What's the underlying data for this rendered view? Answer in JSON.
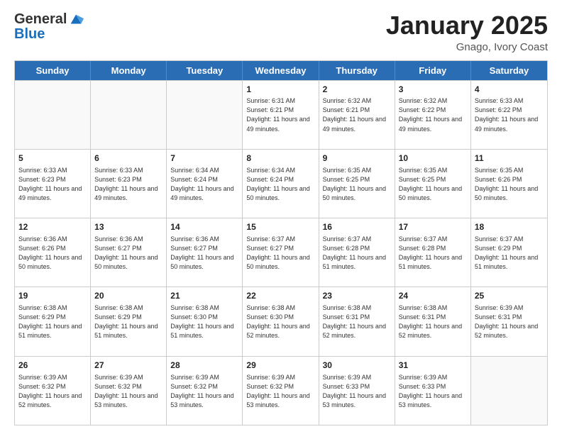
{
  "header": {
    "logo_line1": "General",
    "logo_line2": "Blue",
    "month_title": "January 2025",
    "location": "Gnago, Ivory Coast"
  },
  "days_of_week": [
    "Sunday",
    "Monday",
    "Tuesday",
    "Wednesday",
    "Thursday",
    "Friday",
    "Saturday"
  ],
  "weeks": [
    [
      {
        "day": "",
        "sunrise": "",
        "sunset": "",
        "daylight": ""
      },
      {
        "day": "",
        "sunrise": "",
        "sunset": "",
        "daylight": ""
      },
      {
        "day": "",
        "sunrise": "",
        "sunset": "",
        "daylight": ""
      },
      {
        "day": "1",
        "sunrise": "Sunrise: 6:31 AM",
        "sunset": "Sunset: 6:21 PM",
        "daylight": "Daylight: 11 hours and 49 minutes."
      },
      {
        "day": "2",
        "sunrise": "Sunrise: 6:32 AM",
        "sunset": "Sunset: 6:21 PM",
        "daylight": "Daylight: 11 hours and 49 minutes."
      },
      {
        "day": "3",
        "sunrise": "Sunrise: 6:32 AM",
        "sunset": "Sunset: 6:22 PM",
        "daylight": "Daylight: 11 hours and 49 minutes."
      },
      {
        "day": "4",
        "sunrise": "Sunrise: 6:33 AM",
        "sunset": "Sunset: 6:22 PM",
        "daylight": "Daylight: 11 hours and 49 minutes."
      }
    ],
    [
      {
        "day": "5",
        "sunrise": "Sunrise: 6:33 AM",
        "sunset": "Sunset: 6:23 PM",
        "daylight": "Daylight: 11 hours and 49 minutes."
      },
      {
        "day": "6",
        "sunrise": "Sunrise: 6:33 AM",
        "sunset": "Sunset: 6:23 PM",
        "daylight": "Daylight: 11 hours and 49 minutes."
      },
      {
        "day": "7",
        "sunrise": "Sunrise: 6:34 AM",
        "sunset": "Sunset: 6:24 PM",
        "daylight": "Daylight: 11 hours and 49 minutes."
      },
      {
        "day": "8",
        "sunrise": "Sunrise: 6:34 AM",
        "sunset": "Sunset: 6:24 PM",
        "daylight": "Daylight: 11 hours and 50 minutes."
      },
      {
        "day": "9",
        "sunrise": "Sunrise: 6:35 AM",
        "sunset": "Sunset: 6:25 PM",
        "daylight": "Daylight: 11 hours and 50 minutes."
      },
      {
        "day": "10",
        "sunrise": "Sunrise: 6:35 AM",
        "sunset": "Sunset: 6:25 PM",
        "daylight": "Daylight: 11 hours and 50 minutes."
      },
      {
        "day": "11",
        "sunrise": "Sunrise: 6:35 AM",
        "sunset": "Sunset: 6:26 PM",
        "daylight": "Daylight: 11 hours and 50 minutes."
      }
    ],
    [
      {
        "day": "12",
        "sunrise": "Sunrise: 6:36 AM",
        "sunset": "Sunset: 6:26 PM",
        "daylight": "Daylight: 11 hours and 50 minutes."
      },
      {
        "day": "13",
        "sunrise": "Sunrise: 6:36 AM",
        "sunset": "Sunset: 6:27 PM",
        "daylight": "Daylight: 11 hours and 50 minutes."
      },
      {
        "day": "14",
        "sunrise": "Sunrise: 6:36 AM",
        "sunset": "Sunset: 6:27 PM",
        "daylight": "Daylight: 11 hours and 50 minutes."
      },
      {
        "day": "15",
        "sunrise": "Sunrise: 6:37 AM",
        "sunset": "Sunset: 6:27 PM",
        "daylight": "Daylight: 11 hours and 50 minutes."
      },
      {
        "day": "16",
        "sunrise": "Sunrise: 6:37 AM",
        "sunset": "Sunset: 6:28 PM",
        "daylight": "Daylight: 11 hours and 51 minutes."
      },
      {
        "day": "17",
        "sunrise": "Sunrise: 6:37 AM",
        "sunset": "Sunset: 6:28 PM",
        "daylight": "Daylight: 11 hours and 51 minutes."
      },
      {
        "day": "18",
        "sunrise": "Sunrise: 6:37 AM",
        "sunset": "Sunset: 6:29 PM",
        "daylight": "Daylight: 11 hours and 51 minutes."
      }
    ],
    [
      {
        "day": "19",
        "sunrise": "Sunrise: 6:38 AM",
        "sunset": "Sunset: 6:29 PM",
        "daylight": "Daylight: 11 hours and 51 minutes."
      },
      {
        "day": "20",
        "sunrise": "Sunrise: 6:38 AM",
        "sunset": "Sunset: 6:29 PM",
        "daylight": "Daylight: 11 hours and 51 minutes."
      },
      {
        "day": "21",
        "sunrise": "Sunrise: 6:38 AM",
        "sunset": "Sunset: 6:30 PM",
        "daylight": "Daylight: 11 hours and 51 minutes."
      },
      {
        "day": "22",
        "sunrise": "Sunrise: 6:38 AM",
        "sunset": "Sunset: 6:30 PM",
        "daylight": "Daylight: 11 hours and 52 minutes."
      },
      {
        "day": "23",
        "sunrise": "Sunrise: 6:38 AM",
        "sunset": "Sunset: 6:31 PM",
        "daylight": "Daylight: 11 hours and 52 minutes."
      },
      {
        "day": "24",
        "sunrise": "Sunrise: 6:38 AM",
        "sunset": "Sunset: 6:31 PM",
        "daylight": "Daylight: 11 hours and 52 minutes."
      },
      {
        "day": "25",
        "sunrise": "Sunrise: 6:39 AM",
        "sunset": "Sunset: 6:31 PM",
        "daylight": "Daylight: 11 hours and 52 minutes."
      }
    ],
    [
      {
        "day": "26",
        "sunrise": "Sunrise: 6:39 AM",
        "sunset": "Sunset: 6:32 PM",
        "daylight": "Daylight: 11 hours and 52 minutes."
      },
      {
        "day": "27",
        "sunrise": "Sunrise: 6:39 AM",
        "sunset": "Sunset: 6:32 PM",
        "daylight": "Daylight: 11 hours and 53 minutes."
      },
      {
        "day": "28",
        "sunrise": "Sunrise: 6:39 AM",
        "sunset": "Sunset: 6:32 PM",
        "daylight": "Daylight: 11 hours and 53 minutes."
      },
      {
        "day": "29",
        "sunrise": "Sunrise: 6:39 AM",
        "sunset": "Sunset: 6:32 PM",
        "daylight": "Daylight: 11 hours and 53 minutes."
      },
      {
        "day": "30",
        "sunrise": "Sunrise: 6:39 AM",
        "sunset": "Sunset: 6:33 PM",
        "daylight": "Daylight: 11 hours and 53 minutes."
      },
      {
        "day": "31",
        "sunrise": "Sunrise: 6:39 AM",
        "sunset": "Sunset: 6:33 PM",
        "daylight": "Daylight: 11 hours and 53 minutes."
      },
      {
        "day": "",
        "sunrise": "",
        "sunset": "",
        "daylight": ""
      }
    ]
  ]
}
